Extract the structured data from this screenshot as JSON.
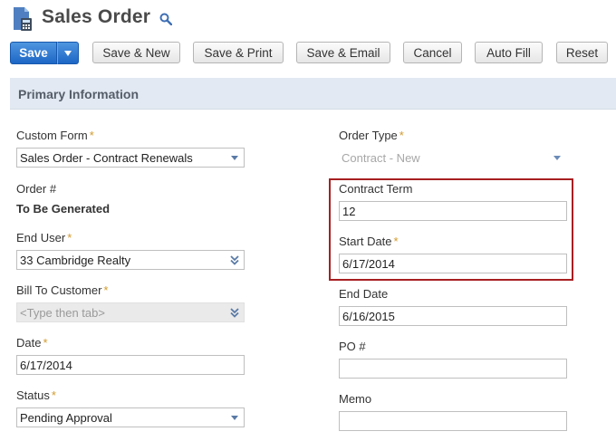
{
  "header": {
    "title": "Sales Order",
    "icon": "document-calculator-icon",
    "search_icon": "search-icon"
  },
  "toolbar": {
    "save_label": "Save",
    "save_new_label": "Save & New",
    "save_print_label": "Save & Print",
    "save_email_label": "Save & Email",
    "cancel_label": "Cancel",
    "auto_fill_label": "Auto Fill",
    "reset_label": "Reset"
  },
  "section": {
    "title": "Primary Information"
  },
  "left": {
    "custom_form": {
      "label": "Custom Form",
      "required": "*",
      "value": "Sales Order - Contract Renewals"
    },
    "order_number": {
      "label": "Order #",
      "value": "To Be Generated"
    },
    "end_user": {
      "label": "End User",
      "required": "*",
      "value": "33 Cambridge Realty"
    },
    "bill_to": {
      "label": "Bill To Customer",
      "required": "*",
      "placeholder": "<Type then tab>"
    },
    "date": {
      "label": "Date",
      "required": "*",
      "value": "6/17/2014"
    },
    "status": {
      "label": "Status",
      "required": "*",
      "value": "Pending Approval"
    }
  },
  "right": {
    "order_type": {
      "label": "Order Type",
      "required": "*",
      "value": "Contract - New"
    },
    "contract_term": {
      "label": "Contract Term",
      "value": "12"
    },
    "start_date": {
      "label": "Start Date",
      "required": "*",
      "value": "6/17/2014"
    },
    "end_date": {
      "label": "End Date",
      "value": "6/16/2015"
    },
    "po_number": {
      "label": "PO #",
      "value": ""
    },
    "memo": {
      "label": "Memo",
      "value": ""
    }
  },
  "colors": {
    "accent": "#1d66c5",
    "section_bg": "#e2e9f2",
    "highlight": "#a71f22",
    "required": "#d49a2b"
  }
}
